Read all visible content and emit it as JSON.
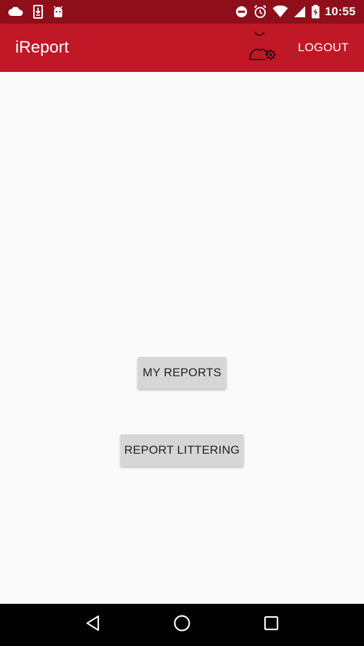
{
  "status_bar": {
    "time": "10:55",
    "icons_left": [
      "cloud-icon",
      "download-icon",
      "android-icon"
    ],
    "icons_right": [
      "do-not-disturb-icon",
      "alarm-icon",
      "wifi-icon",
      "signal-icon",
      "battery-charging-icon"
    ]
  },
  "app_bar": {
    "title": "iReport",
    "profile_icon": "user-settings-icon",
    "logout_label": "LOGOUT"
  },
  "main": {
    "my_reports_label": "MY REPORTS",
    "report_littering_label": "REPORT LITTERING"
  },
  "nav_bar": {
    "buttons": [
      "back-icon",
      "home-icon",
      "recents-icon"
    ]
  },
  "colors": {
    "status_bar": "#8e0e1a",
    "app_bar": "#c01826",
    "background": "#fafafa",
    "button": "#d6d6d6",
    "nav_bar": "#000000"
  }
}
